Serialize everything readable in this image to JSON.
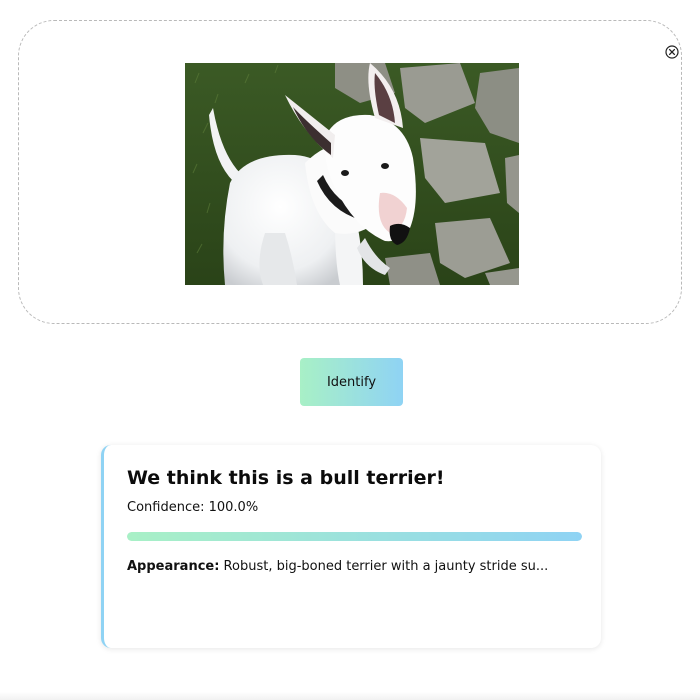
{
  "uploader": {
    "clear_icon": "close-circle-icon",
    "preview_image": "bull-terrier-photo"
  },
  "identify_button": {
    "label": "Identify"
  },
  "result": {
    "title": "We think this is a bull terrier!",
    "confidence_text": "Confidence: 100.0%",
    "confidence_value": 1.0,
    "appearance_label": "Appearance:",
    "appearance_text": " Robust, big-boned terrier with a jaunty stride su..."
  },
  "colors": {
    "accent_start": "#a8f0c6",
    "accent_end": "#8fd3f4"
  }
}
